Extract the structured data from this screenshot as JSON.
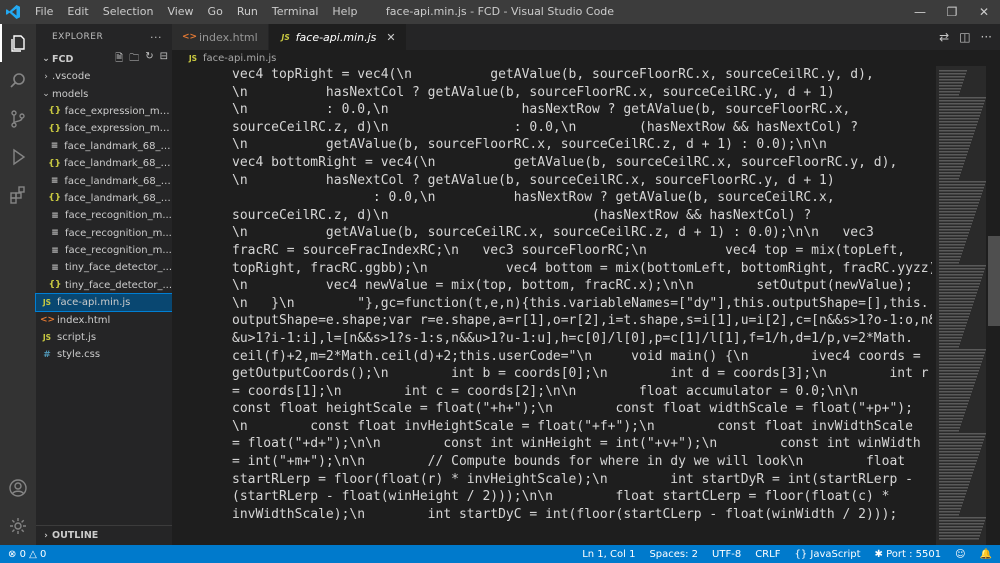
{
  "app": {
    "window_title": "face-api.min.js - FCD - Visual Studio Code",
    "menu": [
      "File",
      "Edit",
      "Selection",
      "View",
      "Go",
      "Run",
      "Terminal",
      "Help"
    ],
    "accent_color": "#007acc"
  },
  "activity_bar": {
    "icons": [
      "explorer-icon",
      "search-icon",
      "source-control-icon",
      "run-debug-icon",
      "extensions-icon"
    ],
    "bottom_icons": [
      "account-icon",
      "settings-gear-icon"
    ]
  },
  "sidebar": {
    "title": "EXPLORER",
    "folder": "FCD",
    "items": [
      {
        "label": ".vscode",
        "type": "folder",
        "depth": 1
      },
      {
        "label": "models",
        "type": "folder-open",
        "depth": 1
      },
      {
        "label": "face_expression_mo...",
        "type": "json",
        "depth": 2
      },
      {
        "label": "face_expression_mo...",
        "type": "json",
        "depth": 2
      },
      {
        "label": "face_landmark_68_m...",
        "type": "file",
        "depth": 2
      },
      {
        "label": "face_landmark_68_m...",
        "type": "json",
        "depth": 2
      },
      {
        "label": "face_landmark_68_ti...",
        "type": "file",
        "depth": 2
      },
      {
        "label": "face_landmark_68_ti...",
        "type": "json",
        "depth": 2
      },
      {
        "label": "face_recognition_m...",
        "type": "file",
        "depth": 2
      },
      {
        "label": "face_recognition_m...",
        "type": "file",
        "depth": 2
      },
      {
        "label": "face_recognition_m...",
        "type": "file",
        "depth": 2
      },
      {
        "label": "tiny_face_detector_...",
        "type": "file",
        "depth": 2
      },
      {
        "label": "tiny_face_detector_...",
        "type": "json",
        "depth": 2
      },
      {
        "label": "face-api.min.js",
        "type": "js",
        "depth": 1,
        "selected": true
      },
      {
        "label": "index.html",
        "type": "html",
        "depth": 1
      },
      {
        "label": "script.js",
        "type": "js",
        "depth": 1
      },
      {
        "label": "style.css",
        "type": "css",
        "depth": 1
      }
    ],
    "outline_label": "OUTLINE"
  },
  "editor": {
    "tabs": [
      {
        "label": "index.html",
        "icon": "html",
        "active": false
      },
      {
        "label": "face-api.min.js",
        "icon": "js",
        "active": true
      }
    ],
    "breadcrumb": "face-api.min.js",
    "code_lines": [
      "vec4 topRight = vec4(\\n          getAValue(b, sourceFloorRC.x, sourceCeilRC.y, d),",
      "\\n          hasNextCol ? getAValue(b, sourceFloorRC.x, sourceCeilRC.y, d + 1)",
      "\\n          : 0.0,\\n                 hasNextRow ? getAValue(b, sourceFloorRC.x,",
      "sourceCeilRC.z, d)\\n                : 0.0,\\n        (hasNextRow && hasNextCol) ?",
      "\\n          getAValue(b, sourceFloorRC.x, sourceCeilRC.z, d + 1) : 0.0);\\n\\n",
      "vec4 bottomRight = vec4(\\n          getAValue(b, sourceCeilRC.x, sourceFloorRC.y, d),",
      "\\n          hasNextCol ? getAValue(b, sourceCeilRC.x, sourceFloorRC.y, d + 1)",
      "                  : 0.0,\\n          hasNextRow ? getAValue(b, sourceCeilRC.x,",
      "sourceCeilRC.z, d)\\n                          (hasNextRow && hasNextCol) ?",
      "\\n          getAValue(b, sourceCeilRC.x, sourceCeilRC.z, d + 1) : 0.0);\\n\\n   vec3",
      "fracRC = sourceFracIndexRC;\\n   vec3 sourceFloorRC;\\n          vec4 top = mix(topLeft,",
      "topRight, fracRC.ggbb);\\n          vec4 bottom = mix(bottomLeft, bottomRight, fracRC.yyzz);",
      "\\n          vec4 newValue = mix(top, bottom, fracRC.x);\\n\\n        setOutput(newValue);",
      "\\n   }\\n        \"},gc=function(t,e,n){this.variableNames=[\"dy\"],this.outputShape=[],this.",
      "outputShape=e.shape;var r=e.shape,a=r[1],o=r[2],i=t.shape,s=i[1],u=i[2],c=[n&&s>1?o-1:o,n&",
      "&u>1?i-1:i],l=[n&&s>1?s-1:s,n&&u>1?u-1:u],h=c[0]/l[0],p=c[1]/l[1],f=1/h,d=1/p,v=2*Math.",
      "ceil(f)+2,m=2*Math.ceil(d)+2;this.userCode=\"\\n     void main() {\\n        ivec4 coords =",
      "getOutputCoords();\\n        int b = coords[0];\\n        int d = coords[3];\\n        int r",
      "= coords[1];\\n        int c = coords[2];\\n\\n        float accumulator = 0.0;\\n\\n",
      "const float heightScale = float(\"+h+\");\\n        const float widthScale = float(\"+p+\");",
      "\\n        const float invHeightScale = float(\"+f+\");\\n        const float invWidthScale",
      "= float(\"+d+\");\\n\\n        const int winHeight = int(\"+v+\");\\n        const int winWidth",
      "= int(\"+m+\");\\n\\n        // Compute bounds for where in dy we will look\\n        float",
      "startRLerp = floor(float(r) * invHeightScale);\\n        int startDyR = int(startRLerp -",
      "(startRLerp - float(winHeight / 2)));\\n\\n        float startCLerp = floor(float(c) *",
      "invWidthScale);\\n        int startDyC = int(floor(startCLerp - float(winWidth / 2)));"
    ]
  },
  "status_bar": {
    "errors": "0",
    "warnings": "0",
    "cursor": "Ln 1, Col 1",
    "spaces": "Spaces: 2",
    "encoding": "UTF-8",
    "eol": "CRLF",
    "language": "JavaScript",
    "port": "Port : 5501"
  }
}
